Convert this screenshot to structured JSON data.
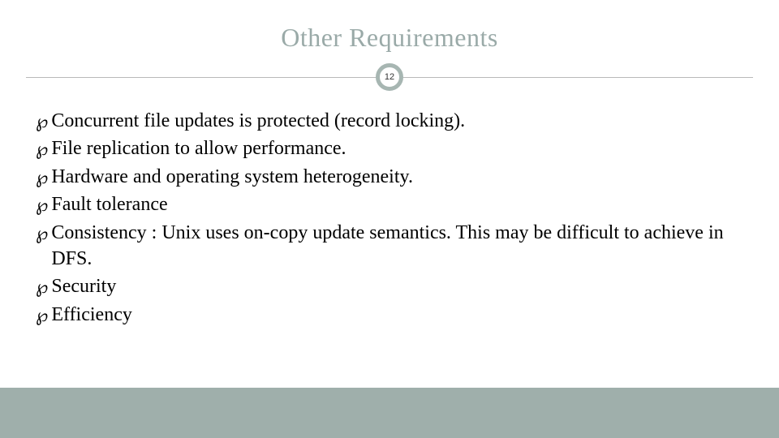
{
  "title": "Other Requirements",
  "page_number": "12",
  "bullets": {
    "b0": "Concurrent file updates is protected (record locking).",
    "b1": "File replication to allow performance.",
    "b2": "Hardware and operating system heterogeneity.",
    "b3": "Fault tolerance",
    "b4": "Consistency : Unix uses on-copy update semantics. This may be difficult to achieve in DFS.",
    "b5": "Security",
    "b6": "Efficiency"
  },
  "bullet_glyph": "℘"
}
